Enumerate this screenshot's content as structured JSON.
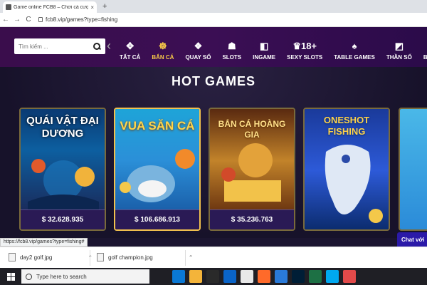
{
  "browser": {
    "tab_title": "Game online FCB8 – Chơi cá cược...",
    "tab_close": "×",
    "new_tab": "+",
    "url": "fcb8.vip/games?type=fishing",
    "back": "←",
    "forward": "→",
    "reload": "C"
  },
  "header": {
    "search_placeholder": "Tìm kiếm ...",
    "prev_arrow": "‹",
    "nav": [
      {
        "label": "TẤT CẢ",
        "icon": "✥"
      },
      {
        "label": "BẮN CÁ",
        "icon": "☸"
      },
      {
        "label": "QUAY SỐ",
        "icon": "❖"
      },
      {
        "label": "SLOTS",
        "icon": "☗"
      },
      {
        "label": "INGAME",
        "icon": "◧"
      },
      {
        "label": "SEXY SLOTS",
        "icon": "♛18+"
      },
      {
        "label": "TABLE GAMES",
        "icon": "♠"
      },
      {
        "label": "THẦN SỐ",
        "icon": "◩"
      },
      {
        "label": "BATTLE",
        "icon": "✕"
      }
    ]
  },
  "main": {
    "heading": "HOT GAMES",
    "games": [
      {
        "title": "QUÁI VẬT ĐẠI DƯƠNG",
        "jackpot": "$ 32.628.935"
      },
      {
        "title": "VUA SĂN CÁ",
        "jackpot": "$ 106.686.913"
      },
      {
        "title": "BẮN CÁ HOÀNG GIA",
        "jackpot": "$ 35.236.763"
      },
      {
        "title": "ONESHOT FISHING",
        "jackpot": ""
      }
    ],
    "chat": "Chat với"
  },
  "status_url": "https://fcb8.vip/games?type=fishing#",
  "downloads": [
    {
      "name": "day2 golf.jpg"
    },
    {
      "name": "golf champion.jpg"
    }
  ],
  "taskbar": {
    "search_text": "Type here to search",
    "icons": [
      "task-view-icon",
      "edge-icon",
      "file-explorer-icon",
      "store-icon",
      "mail-icon",
      "chrome-icon",
      "firefox-icon",
      "photos-icon",
      "photoshop-icon",
      "excel-icon",
      "skype-icon",
      "app-icon"
    ]
  },
  "colors": {
    "header_bg": "#3a0d4c",
    "active_nav": "#f7c948",
    "jackpot_bg": "#2a1a55",
    "chat_bg": "#2b1aa8"
  }
}
